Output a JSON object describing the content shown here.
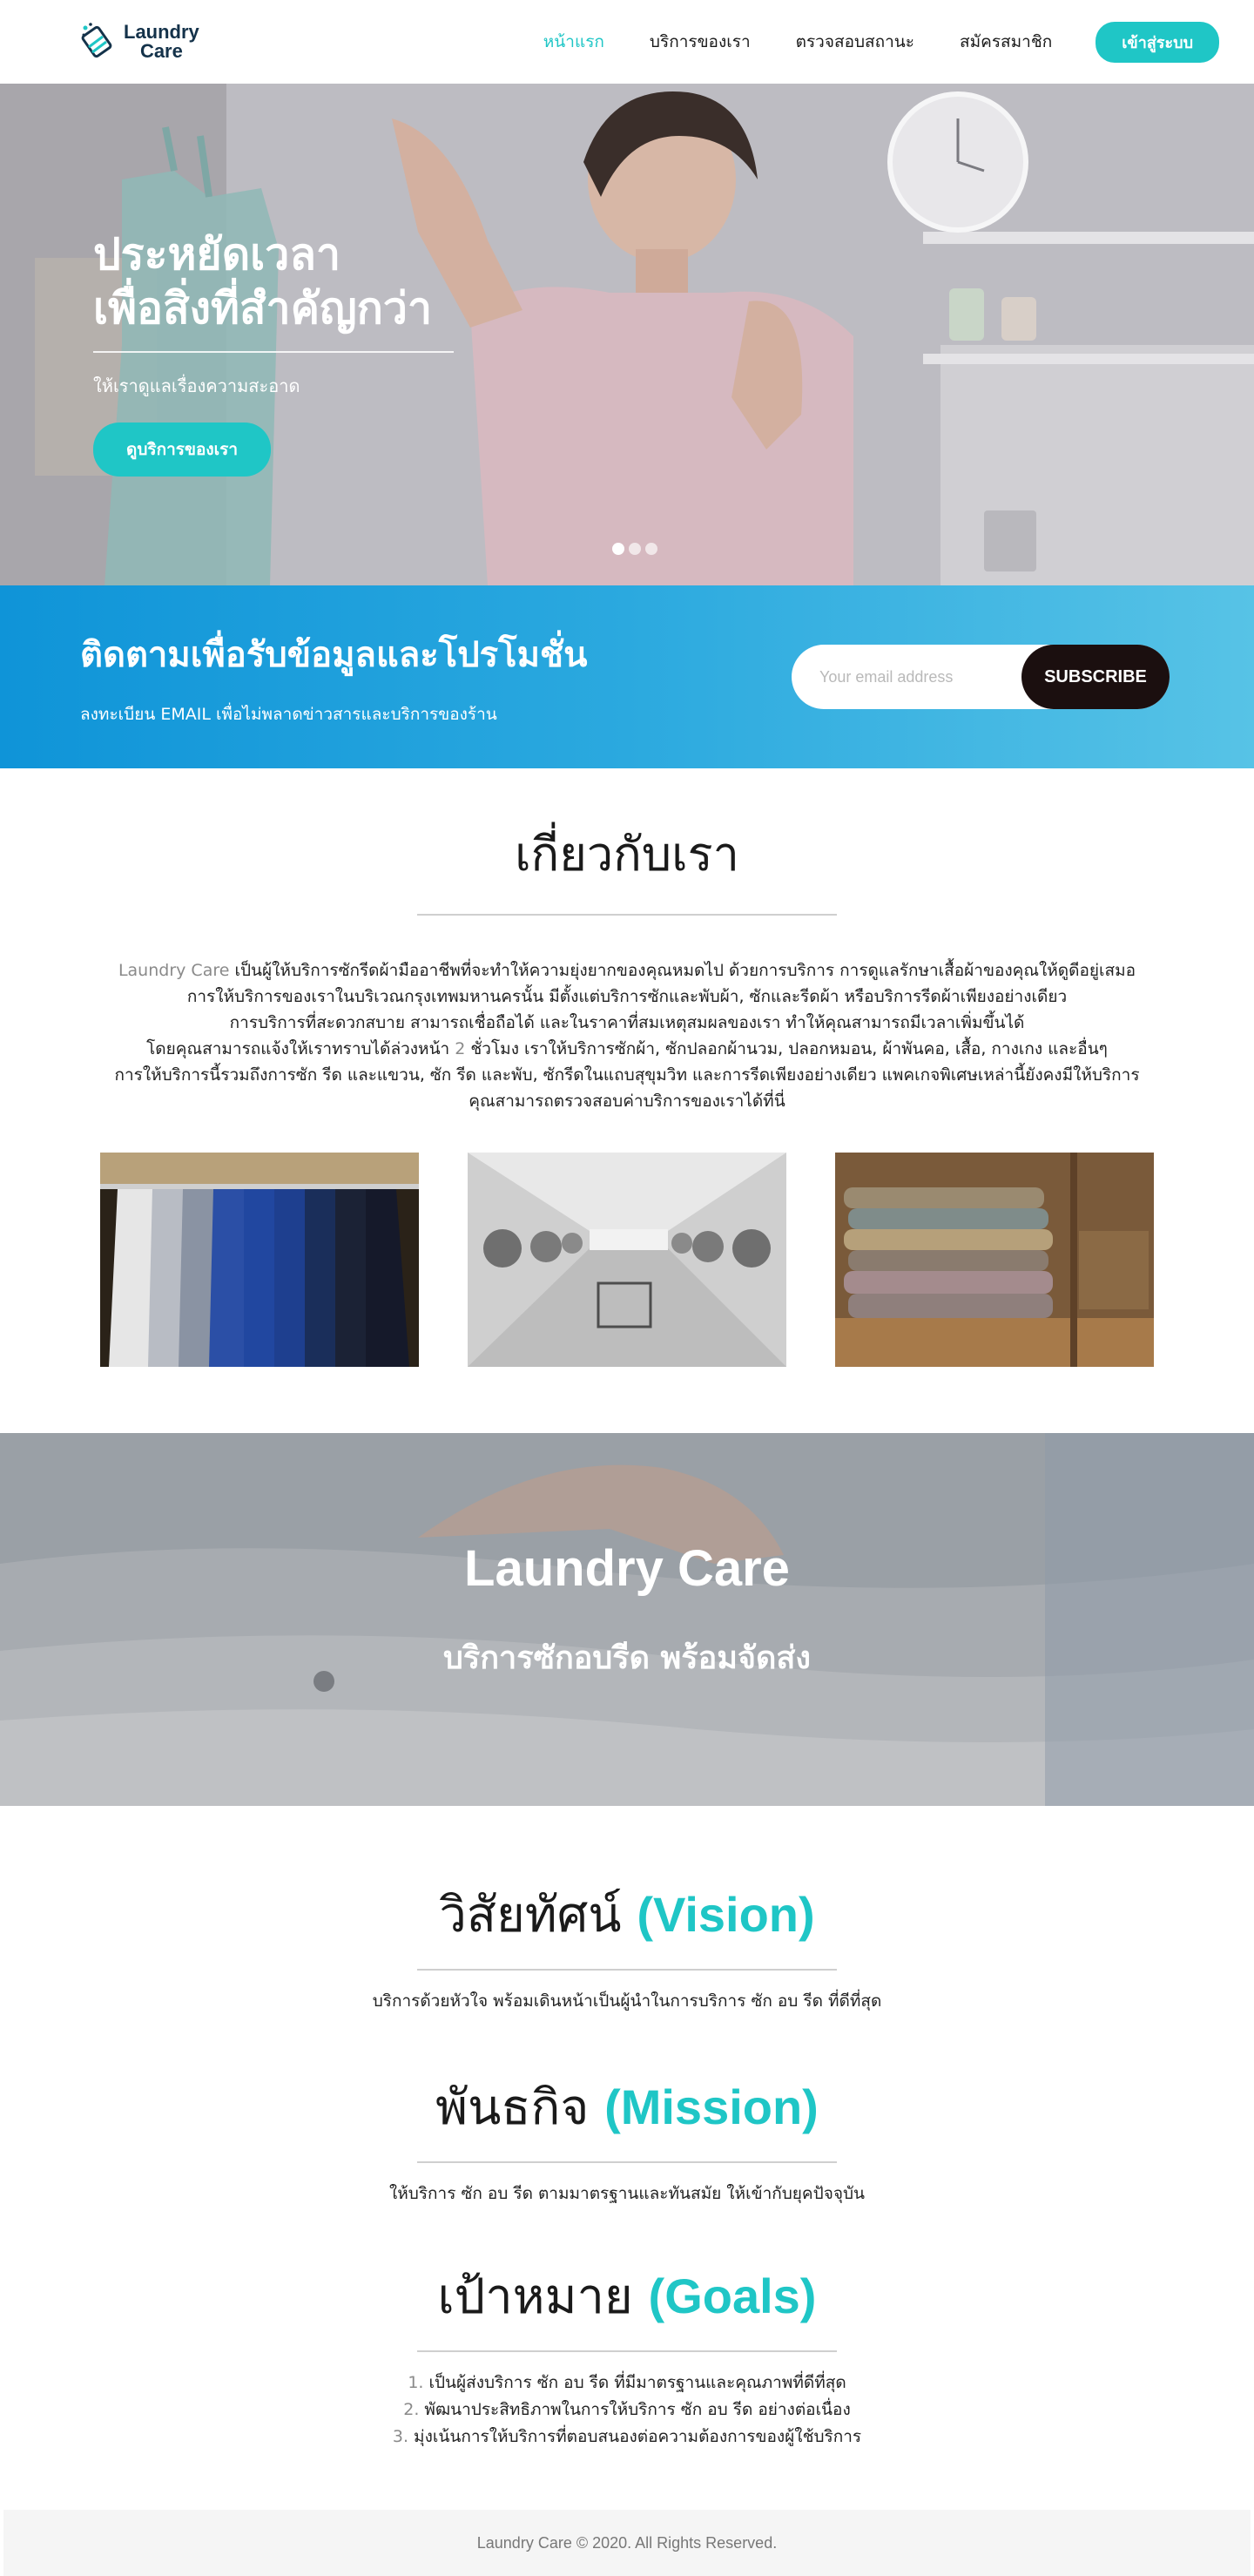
{
  "navbar": {
    "brand": {
      "line1": "Laundry",
      "line2": "Care"
    },
    "links": [
      {
        "label": "หน้าแรก",
        "active": true
      },
      {
        "label": "บริการของเรา",
        "active": false
      },
      {
        "label": "ตรวจสอบสถานะ",
        "active": false
      },
      {
        "label": "สมัครสมาชิก",
        "active": false
      }
    ],
    "login_label": "เข้าสู่ระบบ"
  },
  "hero": {
    "title_line1": "ประหยัดเวลา",
    "title_line2": "เพื่อสิ่งที่สำคัญกว่า",
    "subtitle": "ให้เราดูแลเรื่องความสะอาด",
    "button_label": "ดูบริการของเรา",
    "carousel": {
      "slides": 3,
      "active": 0
    }
  },
  "subscribe": {
    "title": "ติดตามเพื่อรับข้อมูลและโปรโมชั่น",
    "description": "ลงทะเบียน EMAIL เพื่อไม่พลาดข่าวสารและบริการของร้าน",
    "email_placeholder": "Your email address",
    "button_label": "SUBSCRIBE"
  },
  "about": {
    "title": "เกี่ยวกับเรา",
    "lines": [
      {
        "muted": "Laundry Care",
        "text": " เป็นผู้ให้บริการซักรีดผ้ามืออาชีพที่จะทำให้ความยุ่งยากของคุณหมดไป ด้วยการบริการ การดูแลรักษาเสื้อผ้าของคุณให้ดูดีอยู่เสมอ"
      },
      {
        "text": "การให้บริการของเราในบริเวณกรุงเทพมหานครนั้น มีตั้งแต่บริการซักและพับผ้า, ซักและรีดผ้า หรือบริการรีดผ้าเพียงอย่างเดียว"
      },
      {
        "text": "การบริการที่สะดวกสบาย สามารถเชื่อถือได้ และในราคาที่สมเหตุสมผลของเรา ทำให้คุณสามารถมีเวลาเพิ่มขึ้นได้"
      },
      {
        "text_before": "โดยคุณสามารถแจ้งให้เราทราบได้ล่วงหน้า ",
        "muted": "2",
        "text": " ชั่วโมง เราให้บริการซักผ้า, ซักปลอกผ้านวม, ปลอกหมอน, ผ้าพันคอ, เสื้อ, กางเกง และอื่นๆ"
      },
      {
        "text": "การให้บริการนี้รวมถึงการซัก รีด และแขวน, ซัก รีด และพับ, ซักรีดในแถบสุขุมวิท และการรีดเพียงอย่างเดียว แพคเกจพิเศษเหล่านี้ยังคงมีให้บริการ"
      },
      {
        "text": "คุณสามารถตรวจสอบค่าบริการของเราได้ที่นี่"
      }
    ],
    "images": [
      {
        "name": "suits-on-rack-photo"
      },
      {
        "name": "laundromat-photo"
      },
      {
        "name": "folded-towels-photo"
      }
    ]
  },
  "banner": {
    "title": "Laundry Care",
    "subtitle": "บริการซักอบรีด พร้อมจัดส่ง"
  },
  "vision": {
    "title": "วิสัยทัศน์ ",
    "accent": "(Vision)",
    "text": "บริการด้วยหัวใจ พร้อมเดินหน้าเป็นผู้นำในการบริการ ซัก อบ รีด ที่ดีที่สุด"
  },
  "mission": {
    "title": "พันธกิจ ",
    "accent": "(Mission)",
    "text": "ให้บริการ ซัก อบ รีด ตามมาตรฐานและทันสมัย ให้เข้ากับยุคปัจจุบัน"
  },
  "goals": {
    "title": "เป้าหมาย ",
    "accent": "(Goals)",
    "items": [
      {
        "num": "1.",
        "text": " เป็นผู้ส่งบริการ ซัก อบ รีด ที่มีมาตรฐานและคุณภาพที่ดีที่สุด"
      },
      {
        "num": "2.",
        "text": " พัฒนาประสิทธิภาพในการให้บริการ ซัก อบ รีด อย่างต่อเนื่อง"
      },
      {
        "num": "3.",
        "text": " มุ่งเน้นการให้บริการที่ตอบสนองต่อความต้องการของผู้ใช้บริการ"
      }
    ]
  },
  "footer": {
    "text": "Laundry Care © 2020. All Rights Reserved."
  },
  "colors": {
    "accent": "#1fc6c6",
    "brand_navy": "#14324a",
    "subscribe_from": "#0f94d8",
    "subscribe_to": "#57c3e6",
    "subscribe_button": "#1b0f0f"
  }
}
